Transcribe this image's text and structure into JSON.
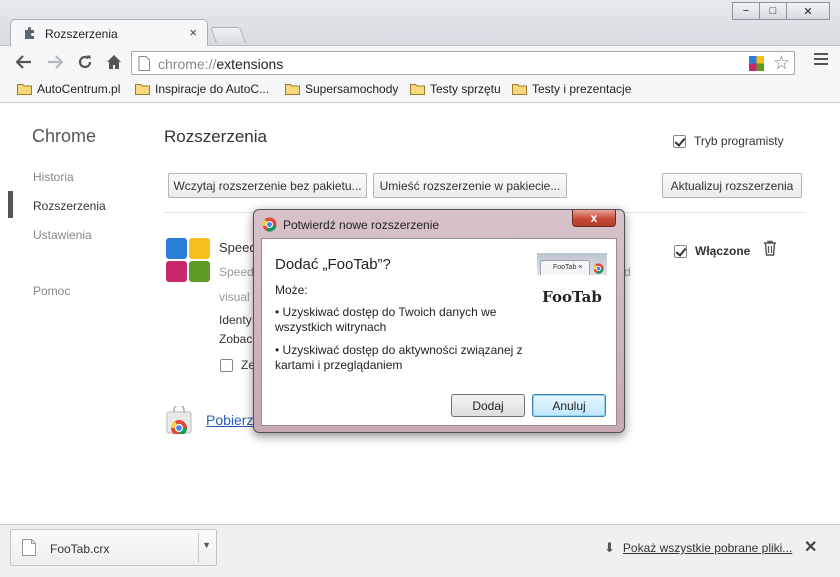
{
  "window": {
    "tab_title": "Rozszerzenia",
    "tab_close": "×",
    "minimize": "−",
    "maximize": "□",
    "close": "✕"
  },
  "toolbar": {
    "url_scheme": "chrome://",
    "url_path": "extensions"
  },
  "bookmarks": [
    {
      "label": "AutoCentrum.pl"
    },
    {
      "label": "Inspiracje do AutoC..."
    },
    {
      "label": "Supersamochody"
    },
    {
      "label": "Testy sprzętu"
    },
    {
      "label": "Testy i prezentacje"
    }
  ],
  "sidebar": {
    "title": "Chrome",
    "items": [
      {
        "label": "Historia"
      },
      {
        "label": "Rozszerzenia"
      },
      {
        "label": "Ustawienia"
      },
      {
        "label": "Pomoc"
      }
    ]
  },
  "main": {
    "title": "Rozszerzenia",
    "dev_mode_label": "Tryb programisty",
    "load_unpacked": "Wczytaj rozszerzenie bez pakietu...",
    "pack_extension": "Umieść rozszerzenie w pakiecie...",
    "update_extensions": "Aktualizuj rozszerzenia",
    "extension": {
      "name": "Speed",
      "desc1": "Speed",
      "desc1_end": "d",
      "desc2": "visual",
      "id_label": "Identy",
      "see_label": "Zobac",
      "incognito_label": "Ze",
      "enabled_label": "Włączone"
    },
    "webstore_link": "Pobierz"
  },
  "dialog": {
    "title": "Potwierdź nowe rozszerzenie",
    "close": "x",
    "heading": "Dodać „FooTab”?",
    "may_label": "Może:",
    "permissions": [
      "• Uzyskiwać dostęp do Twoich danych we wszystkich witrynach",
      "• Uzyskiwać dostęp do aktywności związanej z kartami i przeglądaniem"
    ],
    "screenshot_tab": "FooTab",
    "screenshot_tab_close": "×",
    "screenshot_label": "FooTab",
    "add_button": "Dodaj",
    "cancel_button": "Anuluj"
  },
  "downloads": {
    "file_name": "FooTab.crx",
    "show_all": "Pokaż wszystkie pobrane pliki...",
    "close": "✕"
  },
  "icons": {
    "tab": "puzzle-icon",
    "back": "back-arrow-icon",
    "forward": "forward-arrow-icon",
    "reload": "reload-icon",
    "home": "home-icon",
    "star": "star-icon",
    "menu": "menu-icon",
    "folder": "folder-icon",
    "trash": "trash-icon",
    "file": "file-icon",
    "download": "download-icon"
  }
}
